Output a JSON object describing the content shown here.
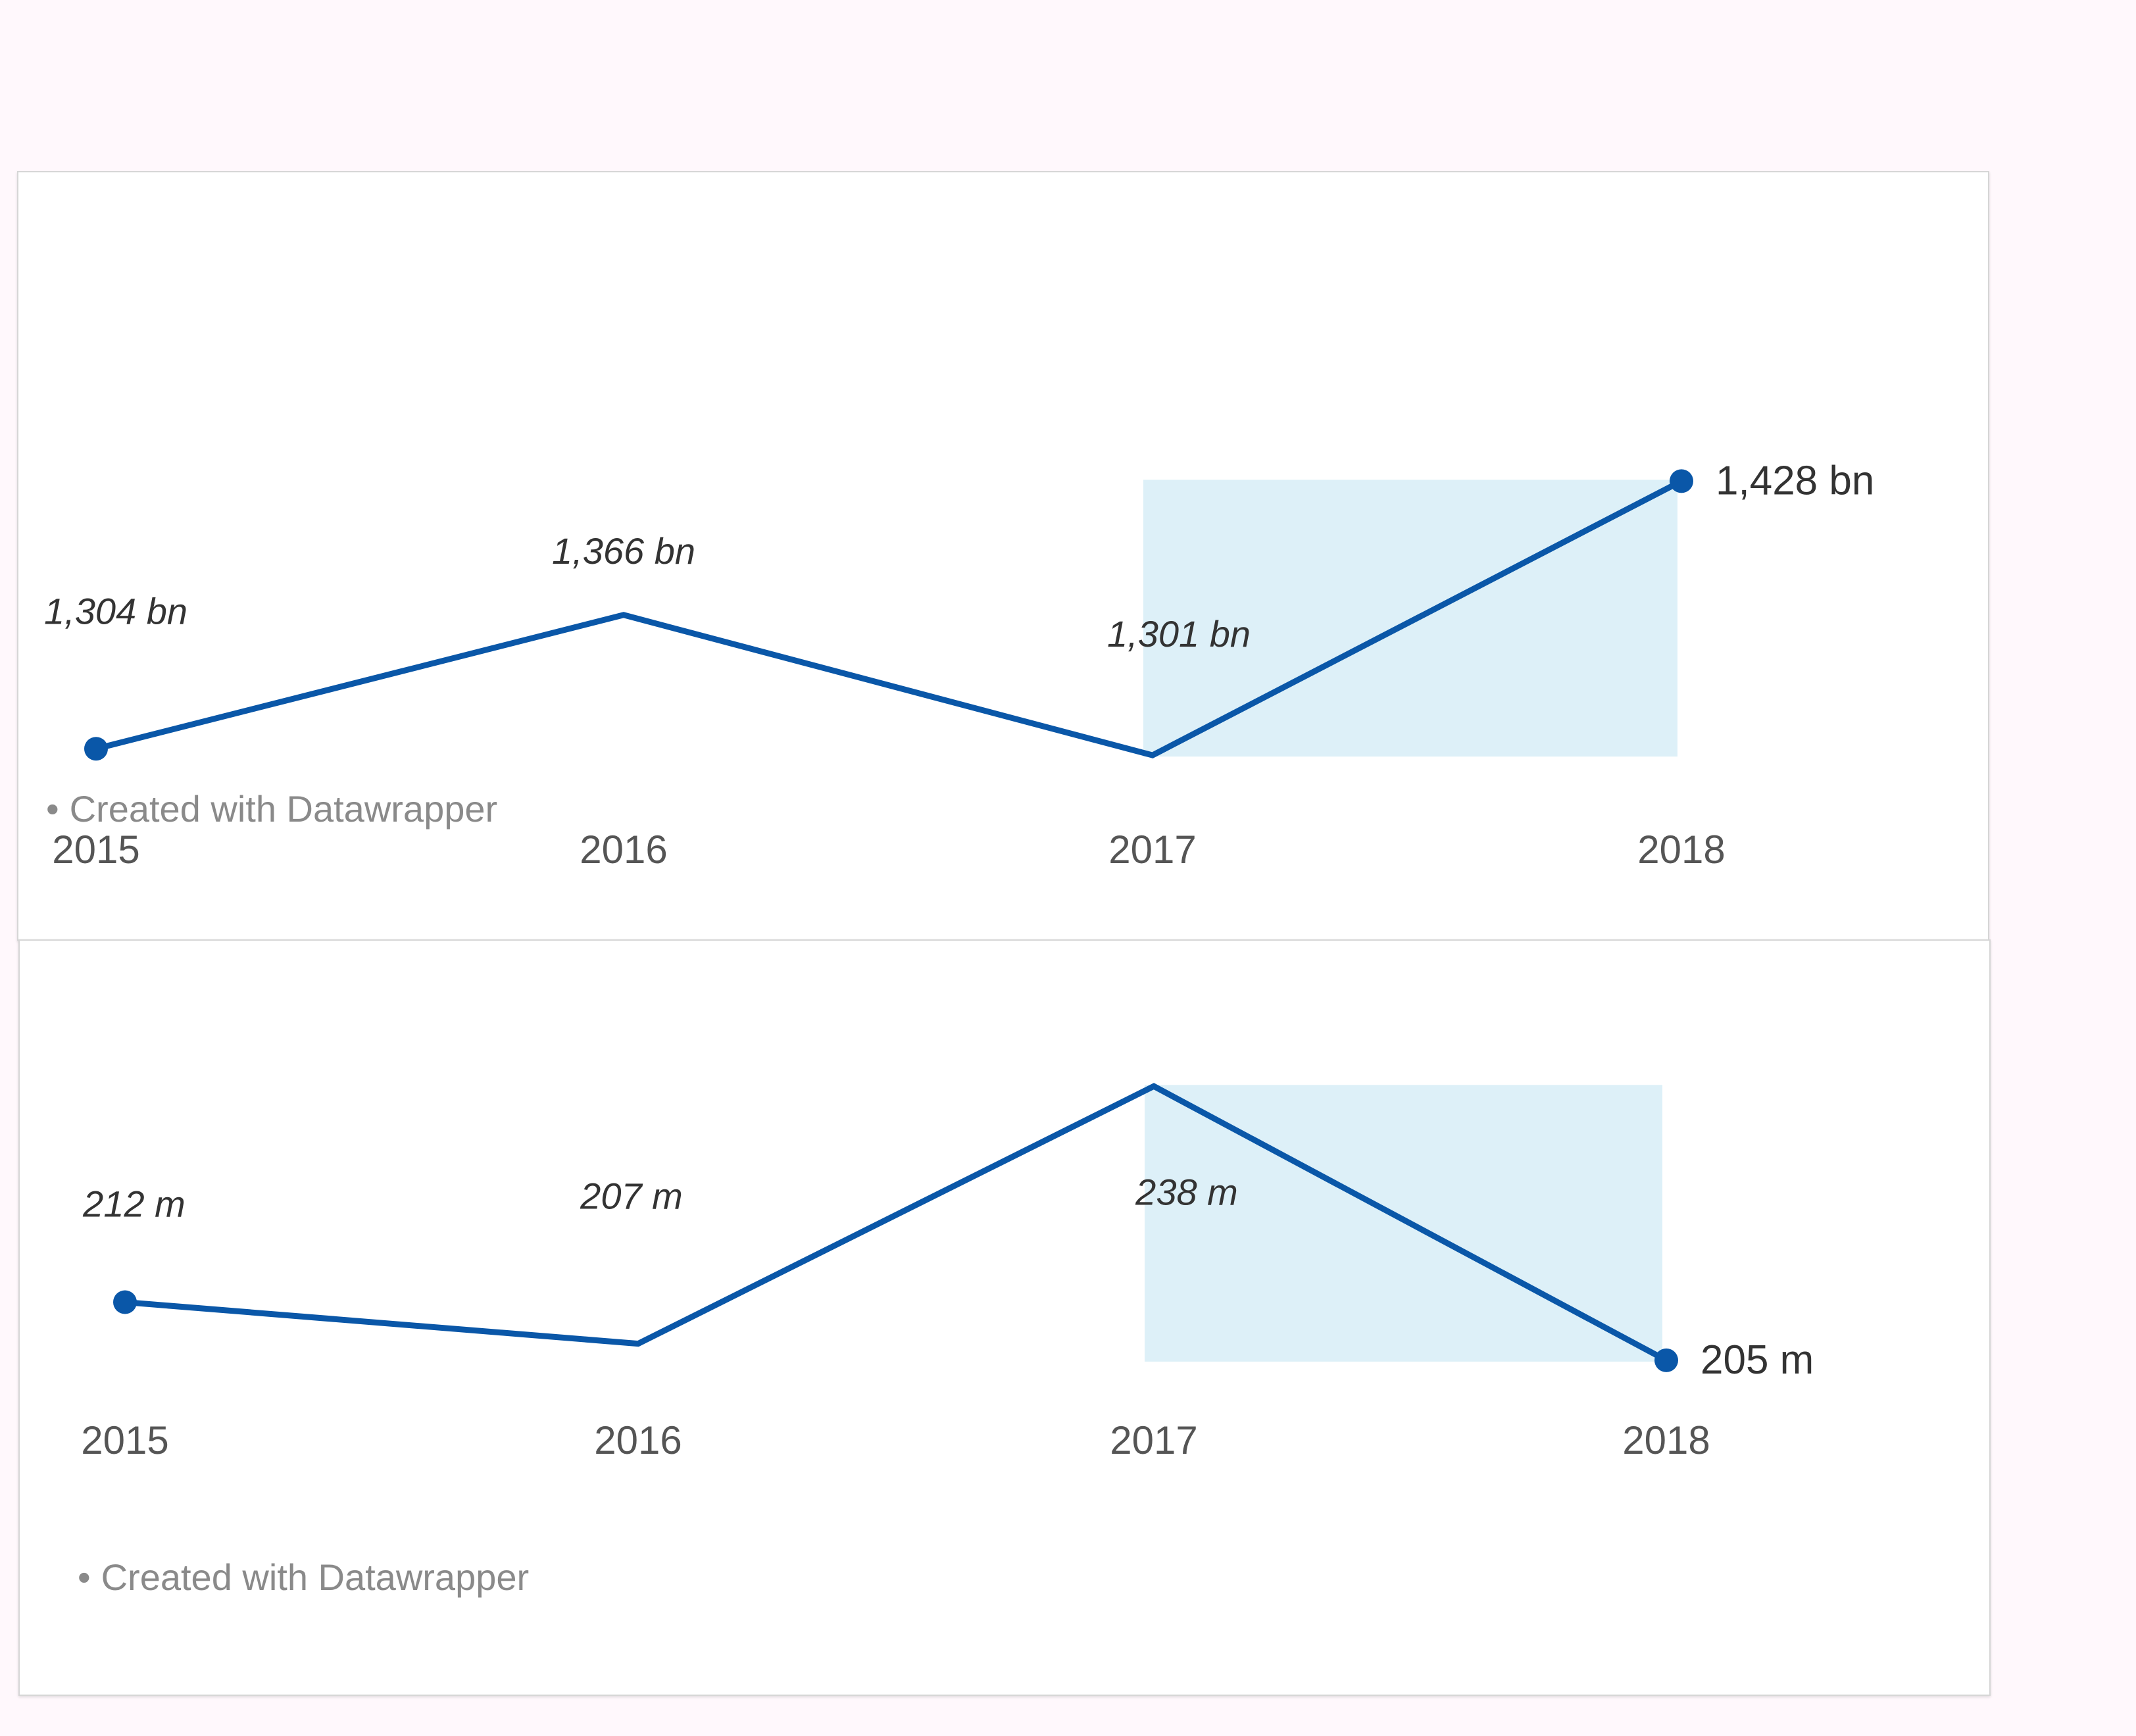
{
  "chart_data": [
    {
      "type": "line",
      "x": [
        "2015",
        "2016",
        "2017",
        "2018"
      ],
      "series": [
        {
          "values": [
            1304,
            1366,
            1301,
            1428
          ]
        }
      ],
      "value_labels": [
        "1,304 bn",
        "1,366 bn",
        "1,301 bn",
        "1,428 bn"
      ],
      "highlight_range": [
        "2017",
        "2018"
      ],
      "ylim": [
        1280,
        1440
      ],
      "credit": "Created with Datawrapper",
      "grid": false,
      "line_color": "#0a57a8",
      "highlight_color": "#ddf0f8"
    },
    {
      "type": "line",
      "x": [
        "2015",
        "2016",
        "2017",
        "2018"
      ],
      "series": [
        {
          "values": [
            212,
            207,
            238,
            205
          ]
        }
      ],
      "value_labels": [
        "212 m",
        "207 m",
        "238 m",
        "205 m"
      ],
      "highlight_range": [
        "2017",
        "2018"
      ],
      "ylim": [
        200,
        240
      ],
      "credit": "Created with Datawrapper",
      "grid": false,
      "line_color": "#0a57a8",
      "highlight_color": "#ddf0f8"
    }
  ]
}
